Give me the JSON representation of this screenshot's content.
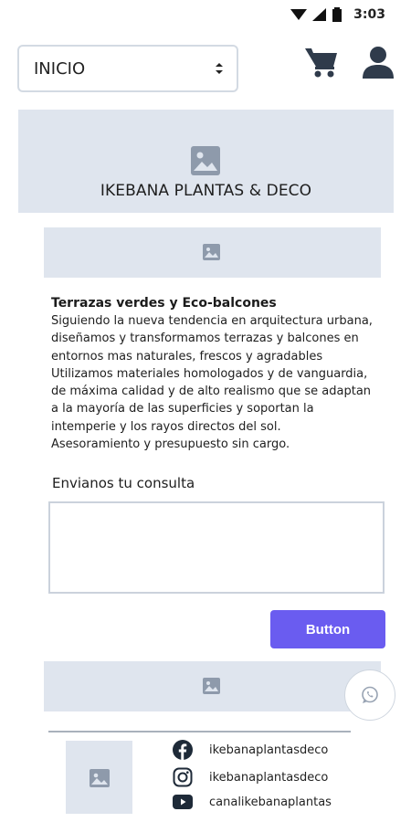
{
  "status_bar": {
    "time": "3:03"
  },
  "header": {
    "select_value": "INICIO",
    "cart_icon": "cart-icon",
    "user_icon": "user-icon"
  },
  "hero": {
    "title": "IKEBANA PLANTAS & DECO",
    "icon": "image-placeholder-icon"
  },
  "article": {
    "title": "Terrazas verdes y Eco-balcones",
    "lines": [
      "Siguiendo la nueva tendencia en arquitectura urbana,",
      "diseñamos y transformamos terrazas y balcones en",
      "entornos mas naturales, frescos y agradables",
      "Utilizamos materiales homologados y de vanguardia,",
      "de máxima calidad y de alto realismo que se adaptan",
      "a la mayoría de las superficies y soportan la",
      "intemperie y los rayos directos del sol.",
      "Asesoramiento y presupuesto sin cargo."
    ]
  },
  "form": {
    "label": "Envianos tu consulta",
    "textarea_value": "",
    "button_label": "Button"
  },
  "footer": {
    "social": [
      {
        "icon": "facebook-icon",
        "label": "ikebanaplantasdeco"
      },
      {
        "icon": "instagram-icon",
        "label": "ikebanaplantasdeco"
      },
      {
        "icon": "youtube-icon",
        "label": "canalikebanaplantas"
      }
    ]
  },
  "colors": {
    "accent": "#6a5cf0",
    "placeholder_bg": "#dfe5ee",
    "icon_dark": "#2f3b4b"
  }
}
